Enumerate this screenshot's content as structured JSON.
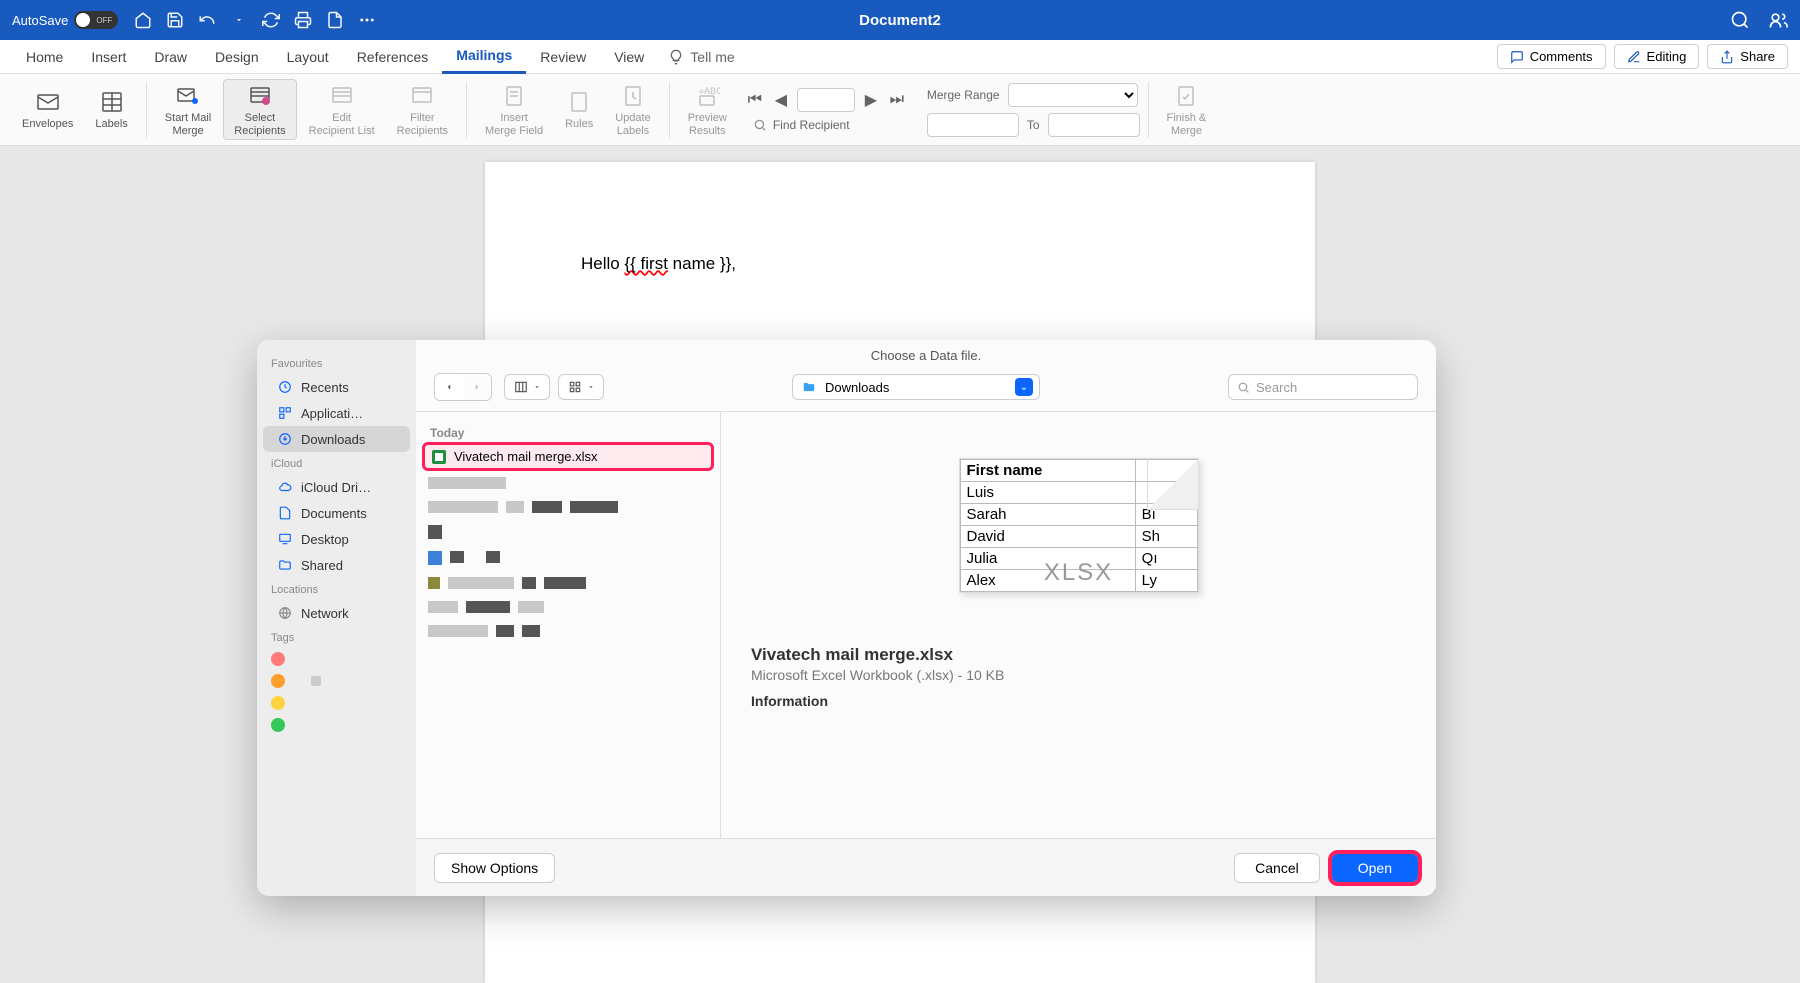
{
  "titlebar": {
    "autosave_label": "AutoSave",
    "autosave_state": "OFF",
    "doc_title": "Document2"
  },
  "tabs": {
    "items": [
      "Home",
      "Insert",
      "Draw",
      "Design",
      "Layout",
      "References",
      "Mailings",
      "Review",
      "View"
    ],
    "active_index": 6,
    "tell_me": "Tell me",
    "comments": "Comments",
    "editing": "Editing",
    "share": "Share"
  },
  "ribbon": {
    "envelopes": "Envelopes",
    "labels": "Labels",
    "start_mail_merge": "Start Mail\nMerge",
    "select_recipients": "Select\nRecipients",
    "edit_recipients": "Edit\nRecipient List",
    "filter_recipients": "Filter\nRecipients",
    "insert_merge_field": "Insert\nMerge Field",
    "rules": "Rules",
    "update_labels": "Update\nLabels",
    "preview_results": "Preview\nResults",
    "find_recipient": "Find Recipient",
    "merge_range_label": "Merge Range",
    "to_label": "To",
    "finish_merge": "Finish &\nMerge"
  },
  "document": {
    "line1_prefix": "Hello ",
    "line1_field": "{{ first",
    "line1_suffix": " name }},"
  },
  "dialog": {
    "title": "Choose a Data file.",
    "location": "Downloads",
    "search_placeholder": "Search",
    "sidebar": {
      "favourites_label": "Favourites",
      "recents": "Recents",
      "applications": "Applicati…",
      "downloads": "Downloads",
      "icloud_label": "iCloud",
      "icloud_drive": "iCloud Dri…",
      "documents": "Documents",
      "desktop": "Desktop",
      "shared": "Shared",
      "locations_label": "Locations",
      "network": "Network",
      "tags_label": "Tags"
    },
    "filelist": {
      "today": "Today",
      "selected_file": "Vivatech mail merge.xlsx"
    },
    "preview": {
      "header": "First name",
      "rows": [
        "Luis",
        "Sarah",
        "David",
        "Julia",
        "Alex"
      ],
      "col2": [
        "",
        "Bı",
        "Sh",
        "Qı",
        "Ly"
      ],
      "overlay": "XLSX",
      "filename": "Vivatech mail merge.xlsx",
      "filedesc": "Microsoft Excel Workbook (.xlsx) - 10 KB",
      "info_heading": "Information"
    },
    "footer": {
      "show_options": "Show Options",
      "cancel": "Cancel",
      "open": "Open"
    }
  },
  "colors": {
    "accent": "#185ABD",
    "highlight": "#FF1F5A",
    "mac_blue": "#0a66ff"
  }
}
